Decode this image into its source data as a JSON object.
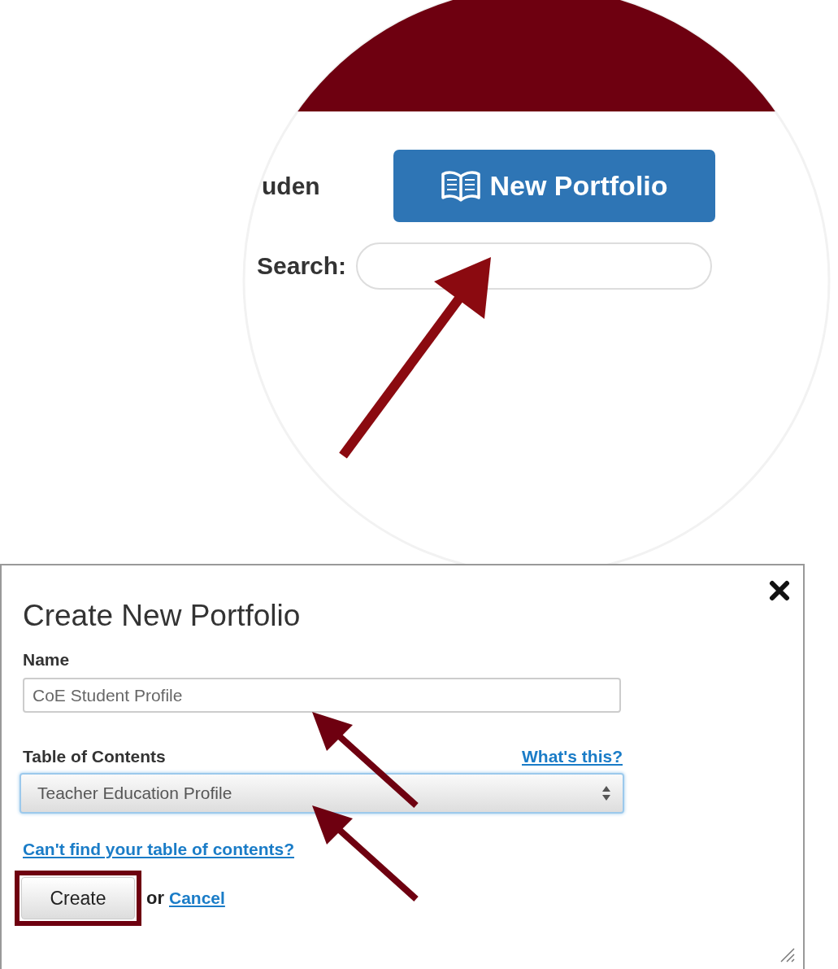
{
  "zoom_callout": {
    "label": "uden",
    "button": "New Portfolio",
    "search_label": "Search:"
  },
  "dialog": {
    "title": "Create New Portfolio",
    "name_label": "Name",
    "name_value": "CoE Student Profile",
    "toc_label": "Table of Contents",
    "help_link": "What's this?",
    "toc_value": "Teacher Education Profile",
    "find_link": "Can't find your table of contents?",
    "create_button": "Create",
    "or_text": "or",
    "cancel_link": "Cancel"
  }
}
